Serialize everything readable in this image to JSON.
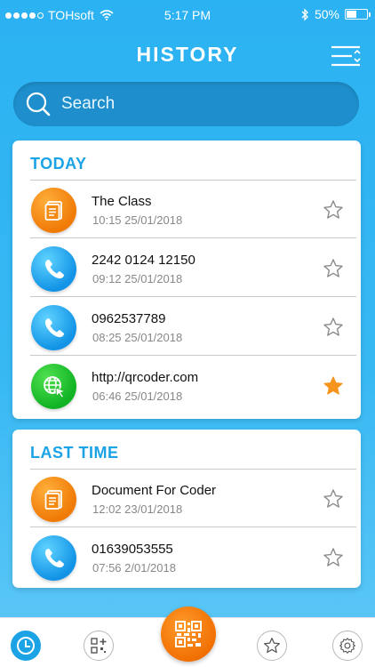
{
  "status_bar": {
    "carrier": "TOHsoft",
    "time": "5:17 PM",
    "battery": "50%",
    "battery_level": 0.5
  },
  "header": {
    "title": "HISTORY"
  },
  "search": {
    "placeholder": "Search"
  },
  "sections": [
    {
      "title": "TODAY",
      "items": [
        {
          "type": "document",
          "title": "The Class",
          "time": "10:15 25/01/2018",
          "starred": false
        },
        {
          "type": "phone",
          "title": "2242 0124 12150",
          "time": "09:12 25/01/2018",
          "starred": false
        },
        {
          "type": "phone",
          "title": "0962537789",
          "time": "08:25 25/01/2018",
          "starred": false
        },
        {
          "type": "web",
          "title": "http://qrcoder.com",
          "time": "06:46 25/01/2018",
          "starred": true
        }
      ]
    },
    {
      "title": "LAST TIME",
      "items": [
        {
          "type": "document",
          "title": "Document For Coder",
          "time": "12:02 23/01/2018",
          "starred": false
        },
        {
          "type": "phone",
          "title": "01639053555",
          "time": "07:56 2/01/2018",
          "starred": false
        }
      ]
    }
  ],
  "bottom_nav": {
    "items": [
      "history-icon",
      "create-qr-icon",
      "scan-qr-icon",
      "favorites-icon",
      "settings-icon"
    ],
    "active": "history-icon"
  },
  "colors": {
    "accent": "#1ba3e6",
    "star_active": "#f7941d",
    "scan_button": "#f07a06"
  }
}
